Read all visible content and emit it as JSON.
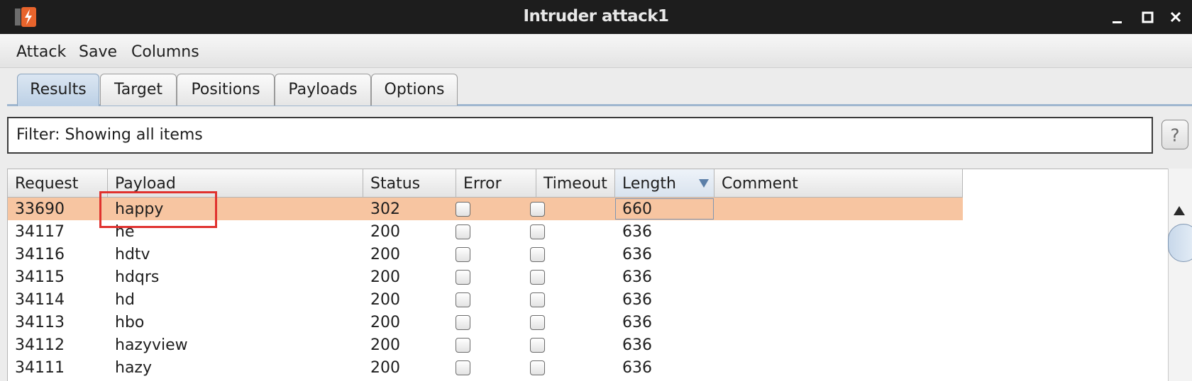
{
  "window": {
    "title": "Intruder attack1",
    "controls": [
      "minimize",
      "maximize",
      "close"
    ]
  },
  "menu": [
    "Attack",
    "Save",
    "Columns"
  ],
  "tabs": [
    {
      "label": "Results",
      "active": true
    },
    {
      "label": "Target",
      "active": false
    },
    {
      "label": "Positions",
      "active": false
    },
    {
      "label": "Payloads",
      "active": false
    },
    {
      "label": "Options",
      "active": false
    }
  ],
  "filter": {
    "text": "Filter:  Showing all items",
    "help_label": "?"
  },
  "table": {
    "columns": [
      "Request",
      "Payload",
      "Status",
      "Error",
      "Timeout",
      "Length",
      "Comment"
    ],
    "sorted_column": "Length",
    "sort_direction": "descending",
    "rows": [
      {
        "request": "33690",
        "payload": "happy",
        "status": "302",
        "error": false,
        "timeout": false,
        "length": "660",
        "comment": "",
        "selected": true
      },
      {
        "request": "34117",
        "payload": "he",
        "status": "200",
        "error": false,
        "timeout": false,
        "length": "636",
        "comment": "",
        "selected": false
      },
      {
        "request": "34116",
        "payload": "hdtv",
        "status": "200",
        "error": false,
        "timeout": false,
        "length": "636",
        "comment": "",
        "selected": false
      },
      {
        "request": "34115",
        "payload": "hdqrs",
        "status": "200",
        "error": false,
        "timeout": false,
        "length": "636",
        "comment": "",
        "selected": false
      },
      {
        "request": "34114",
        "payload": "hd",
        "status": "200",
        "error": false,
        "timeout": false,
        "length": "636",
        "comment": "",
        "selected": false
      },
      {
        "request": "34113",
        "payload": "hbo",
        "status": "200",
        "error": false,
        "timeout": false,
        "length": "636",
        "comment": "",
        "selected": false
      },
      {
        "request": "34112",
        "payload": "hazyview",
        "status": "200",
        "error": false,
        "timeout": false,
        "length": "636",
        "comment": "",
        "selected": false
      },
      {
        "request": "34111",
        "payload": "hazy",
        "status": "200",
        "error": false,
        "timeout": false,
        "length": "636",
        "comment": "",
        "selected": false
      }
    ]
  },
  "colors": {
    "selected_row": "#f7c5a1",
    "highlight_box": "#e0322e",
    "app_icon": "#e8642c"
  },
  "icons": {
    "app": "burp-bolt-icon",
    "minimize": "minimize-icon",
    "maximize": "maximize-icon",
    "close": "close-icon",
    "sort": "sort-down-icon",
    "scroll_up": "scroll-up-icon"
  }
}
